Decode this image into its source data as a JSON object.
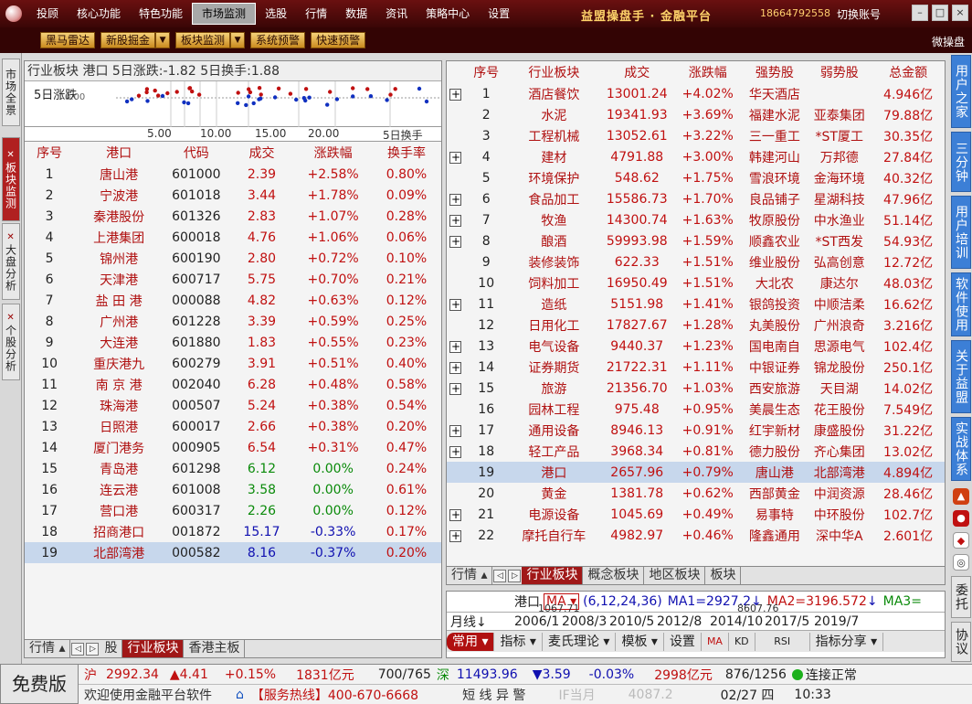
{
  "menubar": {
    "items": [
      "投顾",
      "核心功能",
      "特色功能",
      "市场监测",
      "选股",
      "行情",
      "数据",
      "资讯",
      "策略中心",
      "设置"
    ],
    "brand": "益盟操盘手 · 金融平台",
    "phone": "18664792558",
    "switch_account": "切换账号"
  },
  "toolbar": {
    "buttons": [
      "黑马雷达",
      "新股掘金",
      "板块监测",
      "系统预警",
      "快速预警"
    ],
    "right_label": "微操盘"
  },
  "left_tabs": [
    "市场全景",
    "板块监测",
    "大盘分析",
    "个股分析"
  ],
  "left_panel": {
    "title": "行业板块  港口  5日涨跌:-1.82  5日换手:1.88",
    "mini_chart": {
      "label": "5日涨跌",
      "sub": "0.00",
      "x_ticks": [
        "5.00",
        "10.00",
        "15.00",
        "20.00"
      ],
      "x_label": "5日换手"
    },
    "headers": [
      "序号",
      "港口",
      "代码",
      "成交",
      "涨跌幅",
      "换手率"
    ],
    "rows": [
      {
        "no": "1",
        "name": "唐山港",
        "code": "601000",
        "price": "2.39",
        "chg": "+2.58%",
        "turn": "0.80%",
        "c": "red"
      },
      {
        "no": "2",
        "name": "宁波港",
        "code": "601018",
        "price": "3.44",
        "chg": "+1.78%",
        "turn": "0.09%",
        "c": "red"
      },
      {
        "no": "3",
        "name": "秦港股份",
        "code": "601326",
        "price": "2.83",
        "chg": "+1.07%",
        "turn": "0.28%",
        "c": "red"
      },
      {
        "no": "4",
        "name": "上港集团",
        "code": "600018",
        "price": "4.76",
        "chg": "+1.06%",
        "turn": "0.06%",
        "c": "red"
      },
      {
        "no": "5",
        "name": "锦州港",
        "code": "600190",
        "price": "2.80",
        "chg": "+0.72%",
        "turn": "0.10%",
        "c": "red"
      },
      {
        "no": "6",
        "name": "天津港",
        "code": "600717",
        "price": "5.75",
        "chg": "+0.70%",
        "turn": "0.21%",
        "c": "red"
      },
      {
        "no": "7",
        "name": "盐 田 港",
        "code": "000088",
        "price": "4.82",
        "chg": "+0.63%",
        "turn": "0.12%",
        "c": "red"
      },
      {
        "no": "8",
        "name": "广州港",
        "code": "601228",
        "price": "3.39",
        "chg": "+0.59%",
        "turn": "0.25%",
        "c": "red"
      },
      {
        "no": "9",
        "name": "大连港",
        "code": "601880",
        "price": "1.83",
        "chg": "+0.55%",
        "turn": "0.23%",
        "c": "red"
      },
      {
        "no": "10",
        "name": "重庆港九",
        "code": "600279",
        "price": "3.91",
        "chg": "+0.51%",
        "turn": "0.40%",
        "c": "red"
      },
      {
        "no": "11",
        "name": "南 京 港",
        "code": "002040",
        "price": "6.28",
        "chg": "+0.48%",
        "turn": "0.58%",
        "c": "red"
      },
      {
        "no": "12",
        "name": "珠海港",
        "code": "000507",
        "price": "5.24",
        "chg": "+0.38%",
        "turn": "0.54%",
        "c": "red"
      },
      {
        "no": "13",
        "name": "日照港",
        "code": "600017",
        "price": "2.66",
        "chg": "+0.38%",
        "turn": "0.20%",
        "c": "red"
      },
      {
        "no": "14",
        "name": "厦门港务",
        "code": "000905",
        "price": "6.54",
        "chg": "+0.31%",
        "turn": "0.47%",
        "c": "red"
      },
      {
        "no": "15",
        "name": "青岛港",
        "code": "601298",
        "price": "6.12",
        "chg": "0.00%",
        "turn": "0.24%",
        "c": "green"
      },
      {
        "no": "16",
        "name": "连云港",
        "code": "601008",
        "price": "3.58",
        "chg": "0.00%",
        "turn": "0.61%",
        "c": "green"
      },
      {
        "no": "17",
        "name": "营口港",
        "code": "600317",
        "price": "2.26",
        "chg": "0.00%",
        "turn": "0.12%",
        "c": "green"
      },
      {
        "no": "18",
        "name": "招商港口",
        "code": "001872",
        "price": "15.17",
        "chg": "-0.33%",
        "turn": "0.17%",
        "c": "blue"
      },
      {
        "no": "19",
        "name": "北部湾港",
        "code": "000582",
        "price": "8.16",
        "chg": "-0.37%",
        "turn": "0.20%",
        "c": "blue"
      }
    ],
    "bottom_tabs": [
      "行情",
      "股",
      "行业板块",
      "香港主板"
    ]
  },
  "right_panel": {
    "headers": [
      "序号",
      "行业板块",
      "成交",
      "涨跌幅",
      "强势股",
      "弱势股",
      "总金额"
    ],
    "rows": [
      {
        "no": "1",
        "name": "酒店餐饮",
        "vol": "13001.24",
        "chg": "+4.02%",
        "strong": "华天酒店",
        "weak": "",
        "amt": "4.946亿",
        "plus": true
      },
      {
        "no": "2",
        "name": "水泥",
        "vol": "19341.93",
        "chg": "+3.69%",
        "strong": "福建水泥",
        "weak": "亚泰集团",
        "amt": "79.88亿",
        "plus": false
      },
      {
        "no": "3",
        "name": "工程机械",
        "vol": "13052.61",
        "chg": "+3.22%",
        "strong": "三一重工",
        "weak": "*ST厦工",
        "amt": "30.35亿",
        "plus": false
      },
      {
        "no": "4",
        "name": "建材",
        "vol": "4791.88",
        "chg": "+3.00%",
        "strong": "韩建河山",
        "weak": "万邦德",
        "amt": "27.84亿",
        "plus": true
      },
      {
        "no": "5",
        "name": "环境保护",
        "vol": "548.62",
        "chg": "+1.75%",
        "strong": "雪浪环境",
        "weak": "金海环境",
        "amt": "40.32亿",
        "plus": false
      },
      {
        "no": "6",
        "name": "食品加工",
        "vol": "15586.73",
        "chg": "+1.70%",
        "strong": "良品铺子",
        "weak": "星湖科技",
        "amt": "47.96亿",
        "plus": true
      },
      {
        "no": "7",
        "name": "牧渔",
        "vol": "14300.74",
        "chg": "+1.63%",
        "strong": "牧原股份",
        "weak": "中水渔业",
        "amt": "51.14亿",
        "plus": true
      },
      {
        "no": "8",
        "name": "酿酒",
        "vol": "59993.98",
        "chg": "+1.59%",
        "strong": "顺鑫农业",
        "weak": "*ST西发",
        "amt": "54.93亿",
        "plus": true
      },
      {
        "no": "9",
        "name": "装修装饰",
        "vol": "622.33",
        "chg": "+1.51%",
        "strong": "维业股份",
        "weak": "弘高创意",
        "amt": "12.72亿",
        "plus": false
      },
      {
        "no": "10",
        "name": "饲料加工",
        "vol": "16950.49",
        "chg": "+1.51%",
        "strong": "大北农",
        "weak": "康达尔",
        "amt": "48.03亿",
        "plus": false
      },
      {
        "no": "11",
        "name": "造纸",
        "vol": "5151.98",
        "chg": "+1.41%",
        "strong": "银鸽投资",
        "weak": "中顺洁柔",
        "amt": "16.62亿",
        "plus": true
      },
      {
        "no": "12",
        "name": "日用化工",
        "vol": "17827.67",
        "chg": "+1.28%",
        "strong": "丸美股份",
        "weak": "广州浪奇",
        "amt": "3.216亿",
        "plus": false
      },
      {
        "no": "13",
        "name": "电气设备",
        "vol": "9440.37",
        "chg": "+1.23%",
        "strong": "国电南自",
        "weak": "思源电气",
        "amt": "102.4亿",
        "plus": true
      },
      {
        "no": "14",
        "name": "证券期货",
        "vol": "21722.31",
        "chg": "+1.11%",
        "strong": "中银证券",
        "weak": "锦龙股份",
        "amt": "250.1亿",
        "plus": true
      },
      {
        "no": "15",
        "name": "旅游",
        "vol": "21356.70",
        "chg": "+1.03%",
        "strong": "西安旅游",
        "weak": "天目湖",
        "amt": "14.02亿",
        "plus": true
      },
      {
        "no": "16",
        "name": "园林工程",
        "vol": "975.48",
        "chg": "+0.95%",
        "strong": "美晨生态",
        "weak": "花王股份",
        "amt": "7.549亿",
        "plus": false
      },
      {
        "no": "17",
        "name": "通用设备",
        "vol": "8946.13",
        "chg": "+0.91%",
        "strong": "红宇新材",
        "weak": "康盛股份",
        "amt": "31.22亿",
        "plus": true
      },
      {
        "no": "18",
        "name": "轻工产品",
        "vol": "3968.34",
        "chg": "+0.81%",
        "strong": "德力股份",
        "weak": "齐心集团",
        "amt": "13.02亿",
        "plus": true
      },
      {
        "no": "19",
        "name": "港口",
        "vol": "2657.96",
        "chg": "+0.79%",
        "strong": "唐山港",
        "weak": "北部湾港",
        "amt": "4.894亿",
        "plus": false,
        "sel": true
      },
      {
        "no": "20",
        "name": "黄金",
        "vol": "1381.78",
        "chg": "+0.62%",
        "strong": "西部黄金",
        "weak": "中润资源",
        "amt": "28.46亿",
        "plus": false
      },
      {
        "no": "21",
        "name": "电源设备",
        "vol": "1045.69",
        "chg": "+0.49%",
        "strong": "易事特",
        "weak": "中环股份",
        "amt": "102.7亿",
        "plus": true
      },
      {
        "no": "22",
        "name": "摩托自行车",
        "vol": "4982.97",
        "chg": "+0.46%",
        "strong": "隆鑫通用",
        "weak": "深中华A",
        "amt": "2.601亿",
        "plus": true
      }
    ],
    "bottom_tabs": [
      "行情",
      "行业板块",
      "概念板块",
      "地区板块",
      "板块"
    ]
  },
  "kline": {
    "name": "港口",
    "ma_label": "MA",
    "ma_params": "(6,12,24,36)",
    "ma1": "MA1=2927.2",
    "ma2": "MA2=3196.572",
    "ma3": "MA3=",
    "values": [
      "1067.71",
      "8607.76"
    ],
    "period": "月线",
    "dates": [
      "2006/1",
      "2008/3",
      "2010/5",
      "2012/8",
      "2014/10",
      "2017/5",
      "2019/7"
    ],
    "tools": [
      "常用",
      "指标",
      "麦氏理论",
      "模板",
      "设置",
      "MA",
      "KD",
      "RSI",
      "指标分享"
    ]
  },
  "right_bar": [
    "用户之家",
    "三分钟",
    "用户培训",
    "软件使用",
    "关于益盟",
    "实战体系",
    "委托",
    "协议"
  ],
  "status1": {
    "free": "免费版",
    "sh_label": "沪",
    "sh_index": "2992.34",
    "sh_change": "▲4.41",
    "sh_pct": "+0.15%",
    "sh_amount": "1831亿元",
    "sh_updown": "700/765",
    "sz_label": "深",
    "sz_index": "11493.96",
    "sz_change": "▼3.59",
    "sz_pct": "-0.03%",
    "sz_amount": "2998亿元",
    "sz_updown": "876/1256",
    "connection": "连接正常"
  },
  "status2": {
    "welcome": "欢迎使用金融平台软件",
    "hotline": "【服务热线】400-670-6668",
    "alert": "短  线  异  警",
    "if_label": "IF当月",
    "if_value": "4087.2",
    "date": "02/27 四",
    "time": "10:33"
  }
}
